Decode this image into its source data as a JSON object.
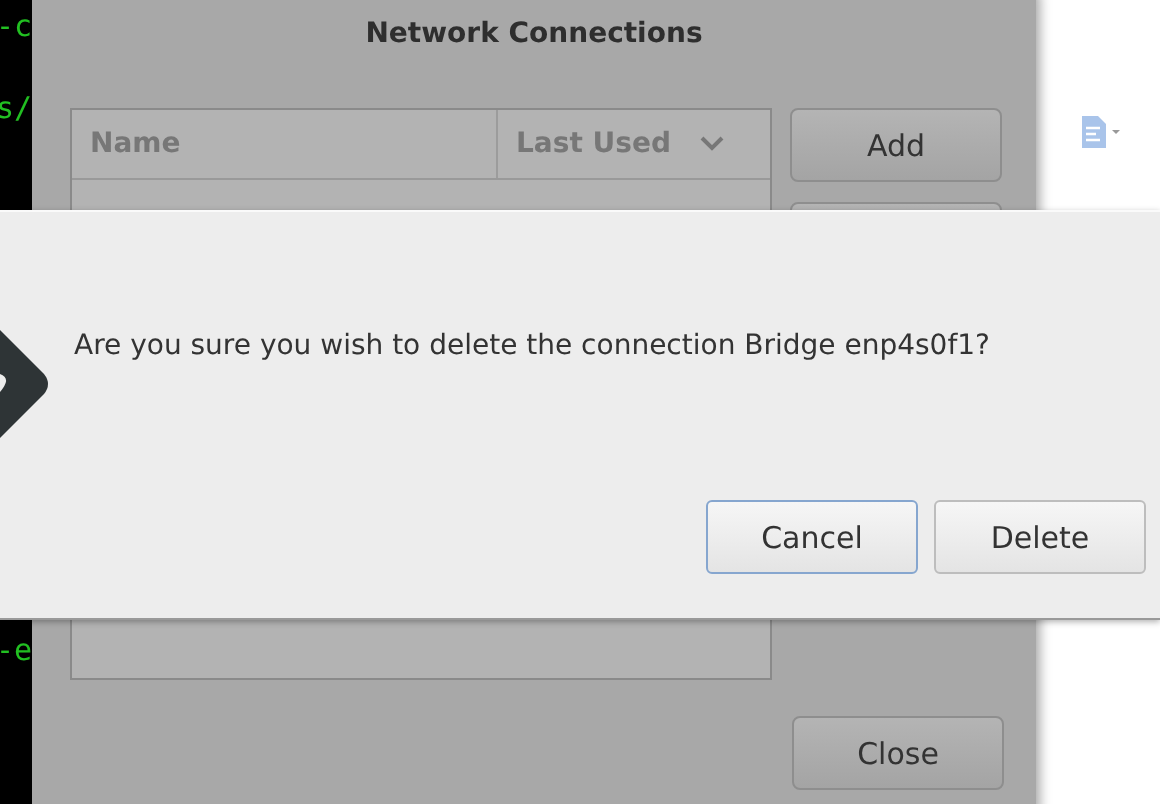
{
  "terminal": {
    "lines": [
      "-c",
      "s/",
      "-e"
    ]
  },
  "window": {
    "title": "Network Connections",
    "columns": [
      "Name",
      "Last Used"
    ],
    "buttons": [
      "Add"
    ],
    "close_button": "Close"
  },
  "dialog": {
    "message": "Are you sure you wish to delete the connection Bridge enp4s0f1?",
    "buttons": [
      {
        "label": "Cancel",
        "focused": true
      },
      {
        "label": "Delete",
        "focused": false
      }
    ]
  }
}
